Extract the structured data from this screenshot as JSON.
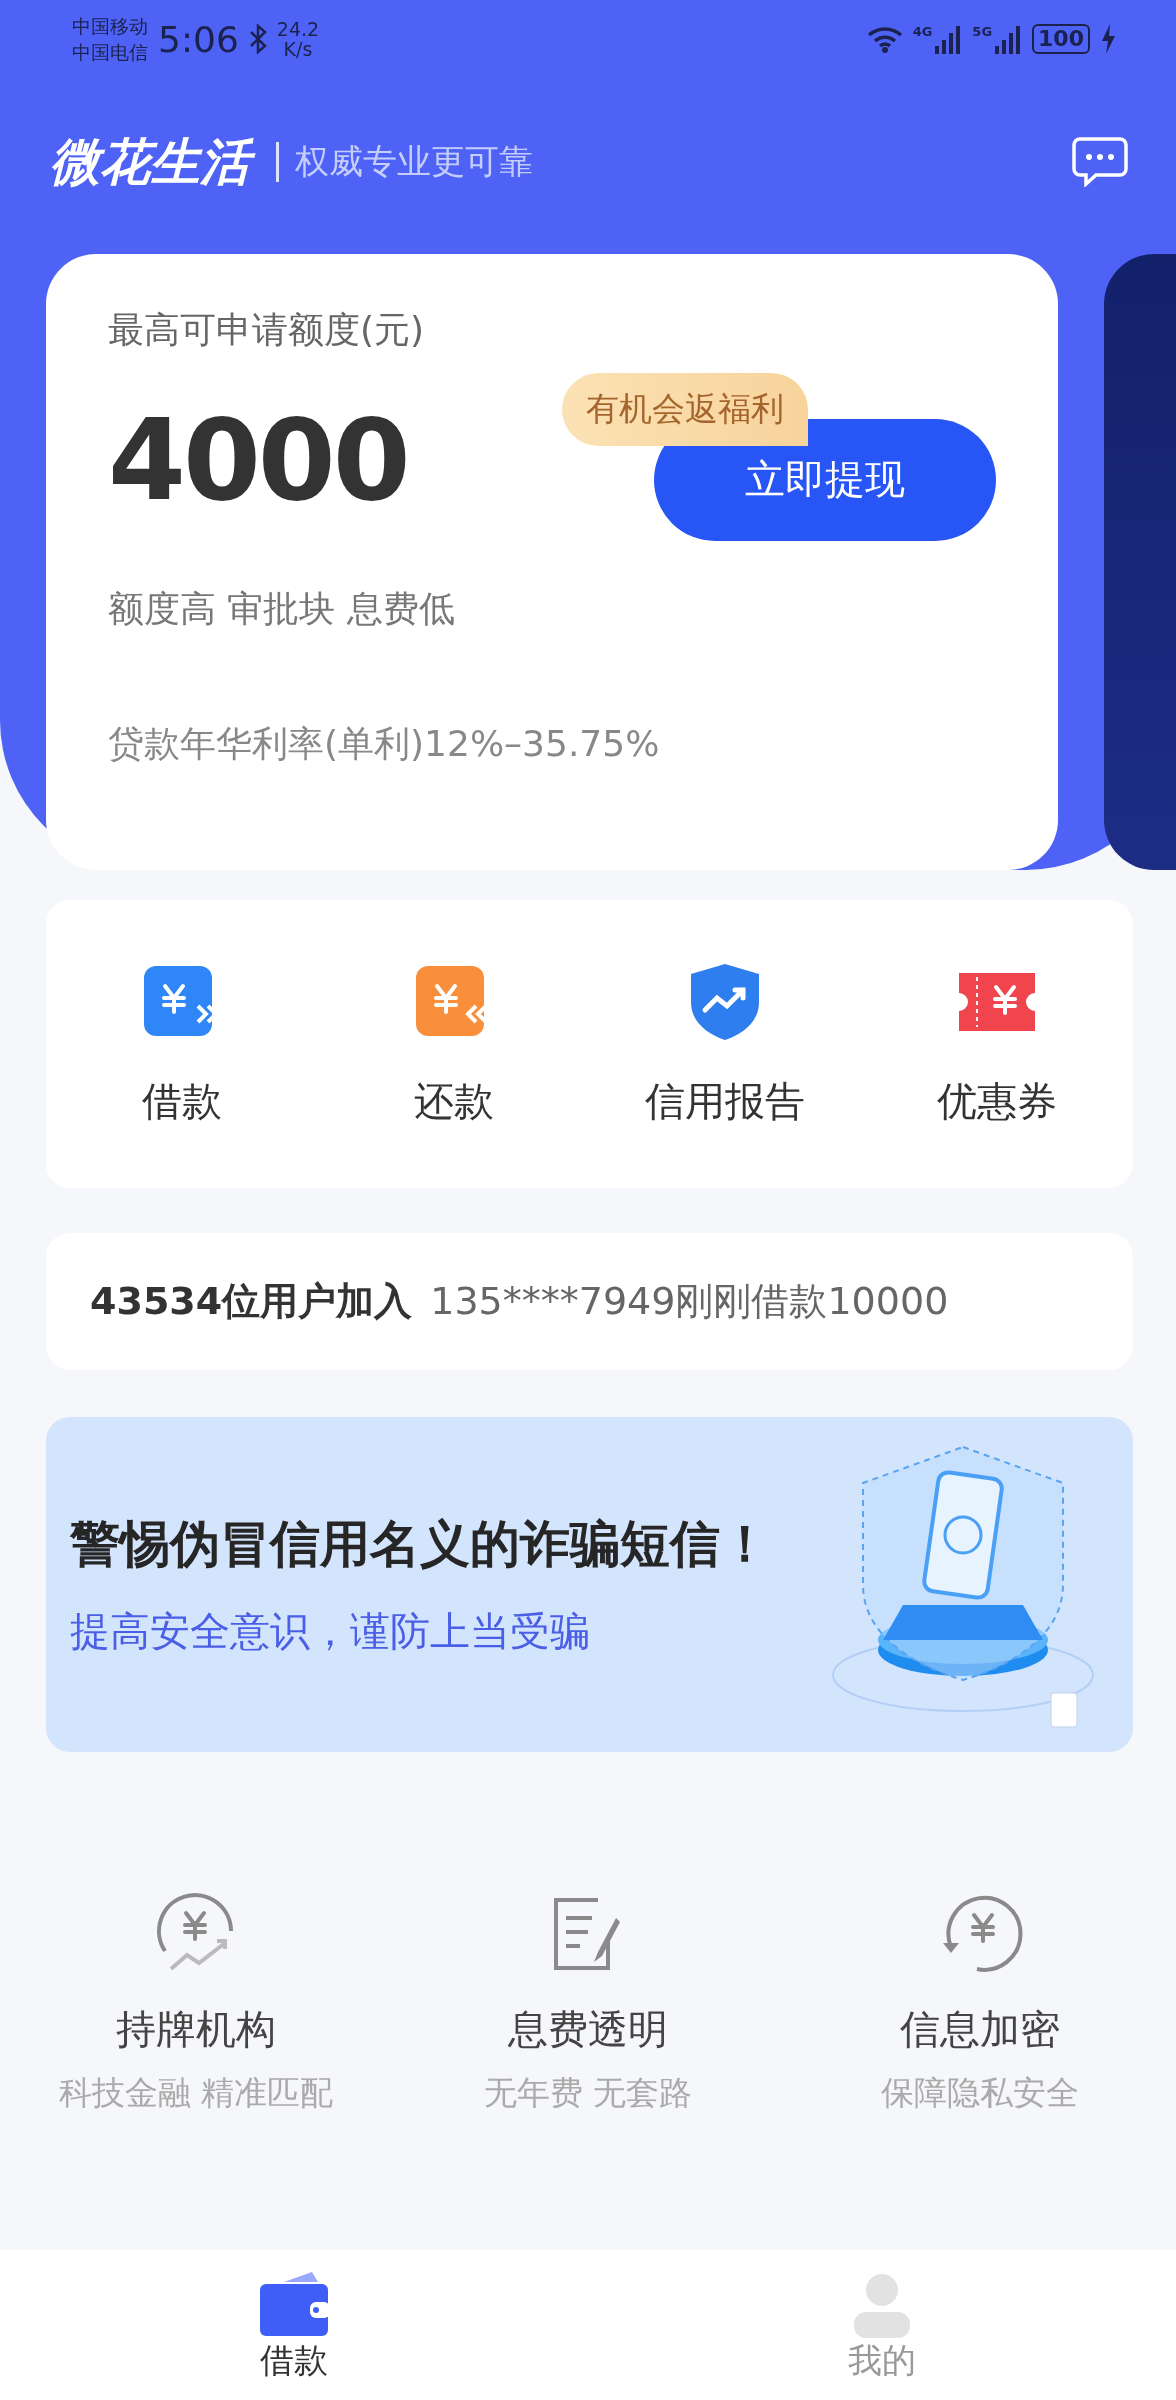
{
  "status_bar": {
    "carriers": [
      "中国移动",
      "中国电信"
    ],
    "time": "5:06",
    "speed": [
      "24.2",
      "K/s"
    ],
    "networks": [
      "4G",
      "5G"
    ],
    "battery": "100"
  },
  "header": {
    "brand": "微花生活",
    "slogan": "权威专业更可靠"
  },
  "credit_card": {
    "label": "最高可申请额度(元)",
    "amount": "4000",
    "badge": "有机会返福利",
    "button": "立即提现",
    "features": "额度高 审批块 息费低",
    "rate": "贷款年华利率(单利)12%–35.75%"
  },
  "quick_actions": [
    {
      "label": "借款",
      "kind": "borrow"
    },
    {
      "label": "还款",
      "kind": "repay"
    },
    {
      "label": "信用报告",
      "kind": "report"
    },
    {
      "label": "优惠券",
      "kind": "coupon"
    }
  ],
  "ticker": {
    "count": "43534位用户加入",
    "message": "135****7949刚刚借款10000"
  },
  "banner": {
    "title": "警惕伪冒信用名义的诈骗短信！",
    "subtitle": "提高安全意识，谨防上当受骗"
  },
  "assurances": [
    {
      "kind": "licensed",
      "title": "持牌机构",
      "subtitle": "科技金融 精准匹配"
    },
    {
      "kind": "transparent",
      "title": "息费透明",
      "subtitle": "无年费 无套路"
    },
    {
      "kind": "encrypted",
      "title": "信息加密",
      "subtitle": "保障隐私安全"
    }
  ],
  "tab_bar": [
    {
      "label": "借款",
      "kind": "wallet",
      "selected": true
    },
    {
      "label": "我的",
      "kind": "profile",
      "selected": false
    }
  ]
}
